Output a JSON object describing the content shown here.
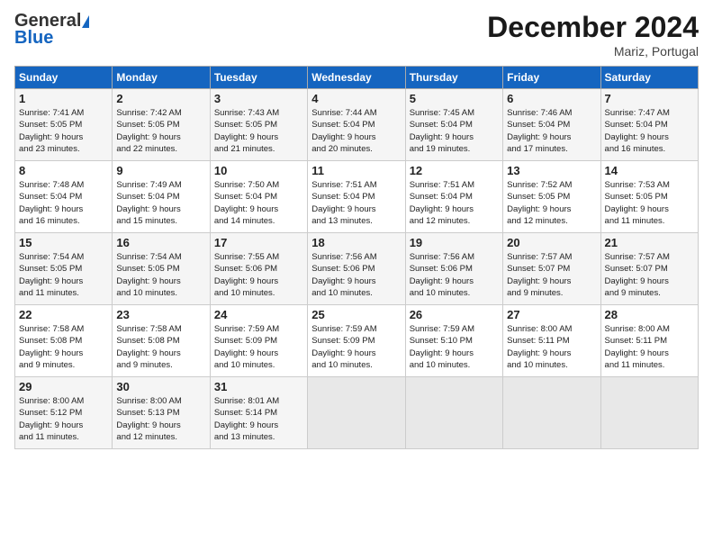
{
  "header": {
    "logo_general": "General",
    "logo_blue": "Blue",
    "month_title": "December 2024",
    "subtitle": "Mariz, Portugal"
  },
  "weekdays": [
    "Sunday",
    "Monday",
    "Tuesday",
    "Wednesday",
    "Thursday",
    "Friday",
    "Saturday"
  ],
  "weeks": [
    [
      {
        "day": "1",
        "info": "Sunrise: 7:41 AM\nSunset: 5:05 PM\nDaylight: 9 hours\nand 23 minutes."
      },
      {
        "day": "2",
        "info": "Sunrise: 7:42 AM\nSunset: 5:05 PM\nDaylight: 9 hours\nand 22 minutes."
      },
      {
        "day": "3",
        "info": "Sunrise: 7:43 AM\nSunset: 5:05 PM\nDaylight: 9 hours\nand 21 minutes."
      },
      {
        "day": "4",
        "info": "Sunrise: 7:44 AM\nSunset: 5:04 PM\nDaylight: 9 hours\nand 20 minutes."
      },
      {
        "day": "5",
        "info": "Sunrise: 7:45 AM\nSunset: 5:04 PM\nDaylight: 9 hours\nand 19 minutes."
      },
      {
        "day": "6",
        "info": "Sunrise: 7:46 AM\nSunset: 5:04 PM\nDaylight: 9 hours\nand 17 minutes."
      },
      {
        "day": "7",
        "info": "Sunrise: 7:47 AM\nSunset: 5:04 PM\nDaylight: 9 hours\nand 16 minutes."
      }
    ],
    [
      {
        "day": "8",
        "info": "Sunrise: 7:48 AM\nSunset: 5:04 PM\nDaylight: 9 hours\nand 16 minutes."
      },
      {
        "day": "9",
        "info": "Sunrise: 7:49 AM\nSunset: 5:04 PM\nDaylight: 9 hours\nand 15 minutes."
      },
      {
        "day": "10",
        "info": "Sunrise: 7:50 AM\nSunset: 5:04 PM\nDaylight: 9 hours\nand 14 minutes."
      },
      {
        "day": "11",
        "info": "Sunrise: 7:51 AM\nSunset: 5:04 PM\nDaylight: 9 hours\nand 13 minutes."
      },
      {
        "day": "12",
        "info": "Sunrise: 7:51 AM\nSunset: 5:04 PM\nDaylight: 9 hours\nand 12 minutes."
      },
      {
        "day": "13",
        "info": "Sunrise: 7:52 AM\nSunset: 5:05 PM\nDaylight: 9 hours\nand 12 minutes."
      },
      {
        "day": "14",
        "info": "Sunrise: 7:53 AM\nSunset: 5:05 PM\nDaylight: 9 hours\nand 11 minutes."
      }
    ],
    [
      {
        "day": "15",
        "info": "Sunrise: 7:54 AM\nSunset: 5:05 PM\nDaylight: 9 hours\nand 11 minutes."
      },
      {
        "day": "16",
        "info": "Sunrise: 7:54 AM\nSunset: 5:05 PM\nDaylight: 9 hours\nand 10 minutes."
      },
      {
        "day": "17",
        "info": "Sunrise: 7:55 AM\nSunset: 5:06 PM\nDaylight: 9 hours\nand 10 minutes."
      },
      {
        "day": "18",
        "info": "Sunrise: 7:56 AM\nSunset: 5:06 PM\nDaylight: 9 hours\nand 10 minutes."
      },
      {
        "day": "19",
        "info": "Sunrise: 7:56 AM\nSunset: 5:06 PM\nDaylight: 9 hours\nand 10 minutes."
      },
      {
        "day": "20",
        "info": "Sunrise: 7:57 AM\nSunset: 5:07 PM\nDaylight: 9 hours\nand 9 minutes."
      },
      {
        "day": "21",
        "info": "Sunrise: 7:57 AM\nSunset: 5:07 PM\nDaylight: 9 hours\nand 9 minutes."
      }
    ],
    [
      {
        "day": "22",
        "info": "Sunrise: 7:58 AM\nSunset: 5:08 PM\nDaylight: 9 hours\nand 9 minutes."
      },
      {
        "day": "23",
        "info": "Sunrise: 7:58 AM\nSunset: 5:08 PM\nDaylight: 9 hours\nand 9 minutes."
      },
      {
        "day": "24",
        "info": "Sunrise: 7:59 AM\nSunset: 5:09 PM\nDaylight: 9 hours\nand 10 minutes."
      },
      {
        "day": "25",
        "info": "Sunrise: 7:59 AM\nSunset: 5:09 PM\nDaylight: 9 hours\nand 10 minutes."
      },
      {
        "day": "26",
        "info": "Sunrise: 7:59 AM\nSunset: 5:10 PM\nDaylight: 9 hours\nand 10 minutes."
      },
      {
        "day": "27",
        "info": "Sunrise: 8:00 AM\nSunset: 5:11 PM\nDaylight: 9 hours\nand 10 minutes."
      },
      {
        "day": "28",
        "info": "Sunrise: 8:00 AM\nSunset: 5:11 PM\nDaylight: 9 hours\nand 11 minutes."
      }
    ],
    [
      {
        "day": "29",
        "info": "Sunrise: 8:00 AM\nSunset: 5:12 PM\nDaylight: 9 hours\nand 11 minutes."
      },
      {
        "day": "30",
        "info": "Sunrise: 8:00 AM\nSunset: 5:13 PM\nDaylight: 9 hours\nand 12 minutes."
      },
      {
        "day": "31",
        "info": "Sunrise: 8:01 AM\nSunset: 5:14 PM\nDaylight: 9 hours\nand 13 minutes."
      },
      {
        "day": "",
        "info": ""
      },
      {
        "day": "",
        "info": ""
      },
      {
        "day": "",
        "info": ""
      },
      {
        "day": "",
        "info": ""
      }
    ]
  ]
}
